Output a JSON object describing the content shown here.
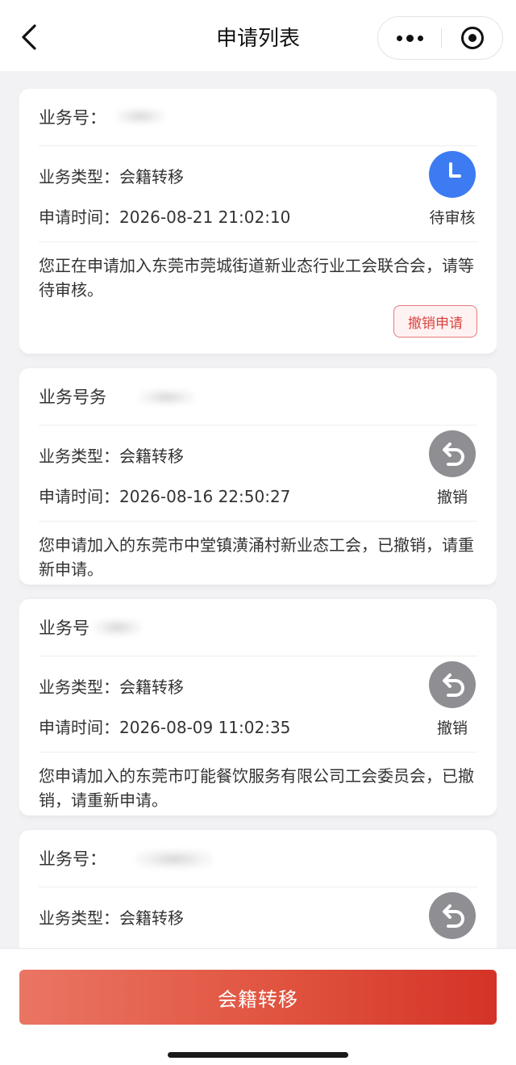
{
  "header": {
    "title": "申请列表"
  },
  "applications": [
    {
      "no_label": "业务号：",
      "type_line": "业务类型：会籍转移",
      "time_line": "申请时间：2026-08-21 21:02:10",
      "status": "待审核",
      "status_icon": "clock-icon",
      "description": "您正在申请加入东莞市莞城街道新业态行业工会联合会，请等待审核。",
      "action_label": "撤销申请"
    },
    {
      "no_label": "业务号务",
      "type_line": "业务类型：会籍转移",
      "time_line": "申请时间：2026-08-16 22:50:27",
      "status": "撤销",
      "status_icon": "undo-icon",
      "description": "您申请加入的东莞市中堂镇潢涌村新业态工会，已撤销，请重新申请。"
    },
    {
      "no_label": "业务号",
      "type_line": "业务类型：会籍转移",
      "time_line": "申请时间：2026-08-09 11:02:35",
      "status": "撤销",
      "status_icon": "undo-icon",
      "description": "您申请加入的东莞市叮能餐饮服务有限公司工会委员会，已撤销，请重新申请。"
    },
    {
      "no_label": "业务号：",
      "type_line": "业务类型：会籍转移",
      "status_icon": "undo-icon"
    }
  ],
  "footer": {
    "button_label": "会籍转移"
  },
  "colors": {
    "accent_red": "#d9453f",
    "status_blue": "#3d7bf2",
    "status_gray": "#8e8e93"
  }
}
